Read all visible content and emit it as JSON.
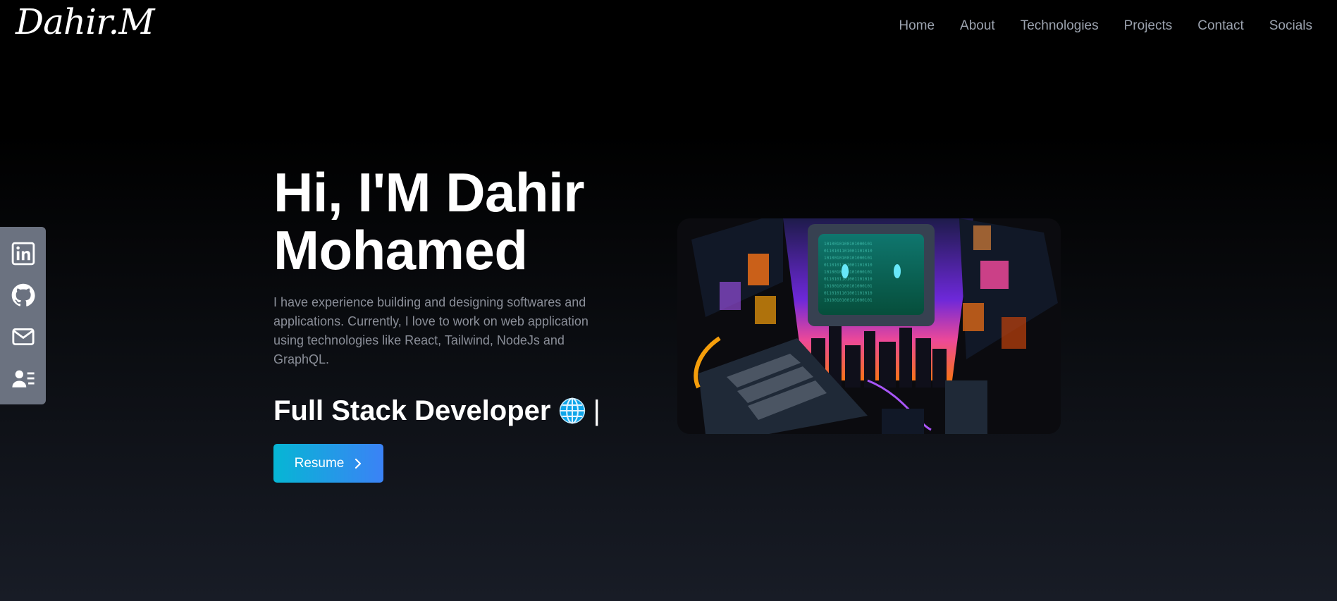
{
  "header": {
    "logo_text": "Dahir.M",
    "nav": [
      "Home",
      "About",
      "Technologies",
      "Projects",
      "Contact",
      "Socials"
    ]
  },
  "social_bar": {
    "icons": [
      "linkedin-icon",
      "github-icon",
      "mail-icon",
      "resume-contact-icon"
    ]
  },
  "hero": {
    "title_line1": "Hi, I'M Dahir",
    "title_line2": "Mohamed",
    "description": "I have experience building and designing softwares and applications. Currently, I love to work on web application using technologies like React, Tailwind, NodeJs and GraphQL.",
    "role": "Full Stack Developer",
    "cursor": "|",
    "resume_button": "Resume"
  },
  "colors": {
    "button_gradient_start": "#06b6d4",
    "button_gradient_end": "#3b82f6",
    "nav_text": "#9ca3af",
    "social_bar_bg": "#6b7280"
  }
}
